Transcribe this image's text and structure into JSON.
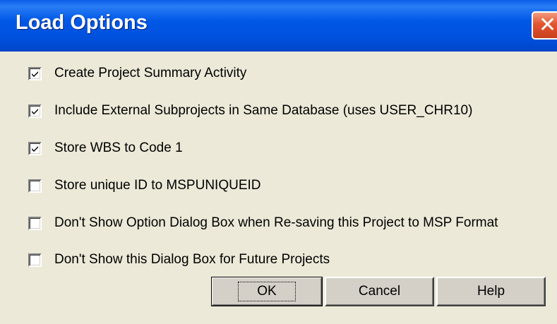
{
  "dialog": {
    "title": "Load Options",
    "close_glyph": "✕"
  },
  "options": [
    {
      "label": "Create Project Summary Activity",
      "checked": true
    },
    {
      "label": "Include External Subprojects in Same Database (uses USER_CHR10)",
      "checked": true
    },
    {
      "label": "Store WBS to Code 1",
      "checked": true
    },
    {
      "label": "Store unique ID to MSPUNIQUEID",
      "checked": false
    },
    {
      "label": "Don't Show Option Dialog Box when Re-saving this Project to MSP Format",
      "checked": false
    },
    {
      "label": "Don't Show this Dialog Box for Future Projects",
      "checked": false
    }
  ],
  "buttons": {
    "ok": "OK",
    "cancel": "Cancel",
    "help": "Help"
  }
}
